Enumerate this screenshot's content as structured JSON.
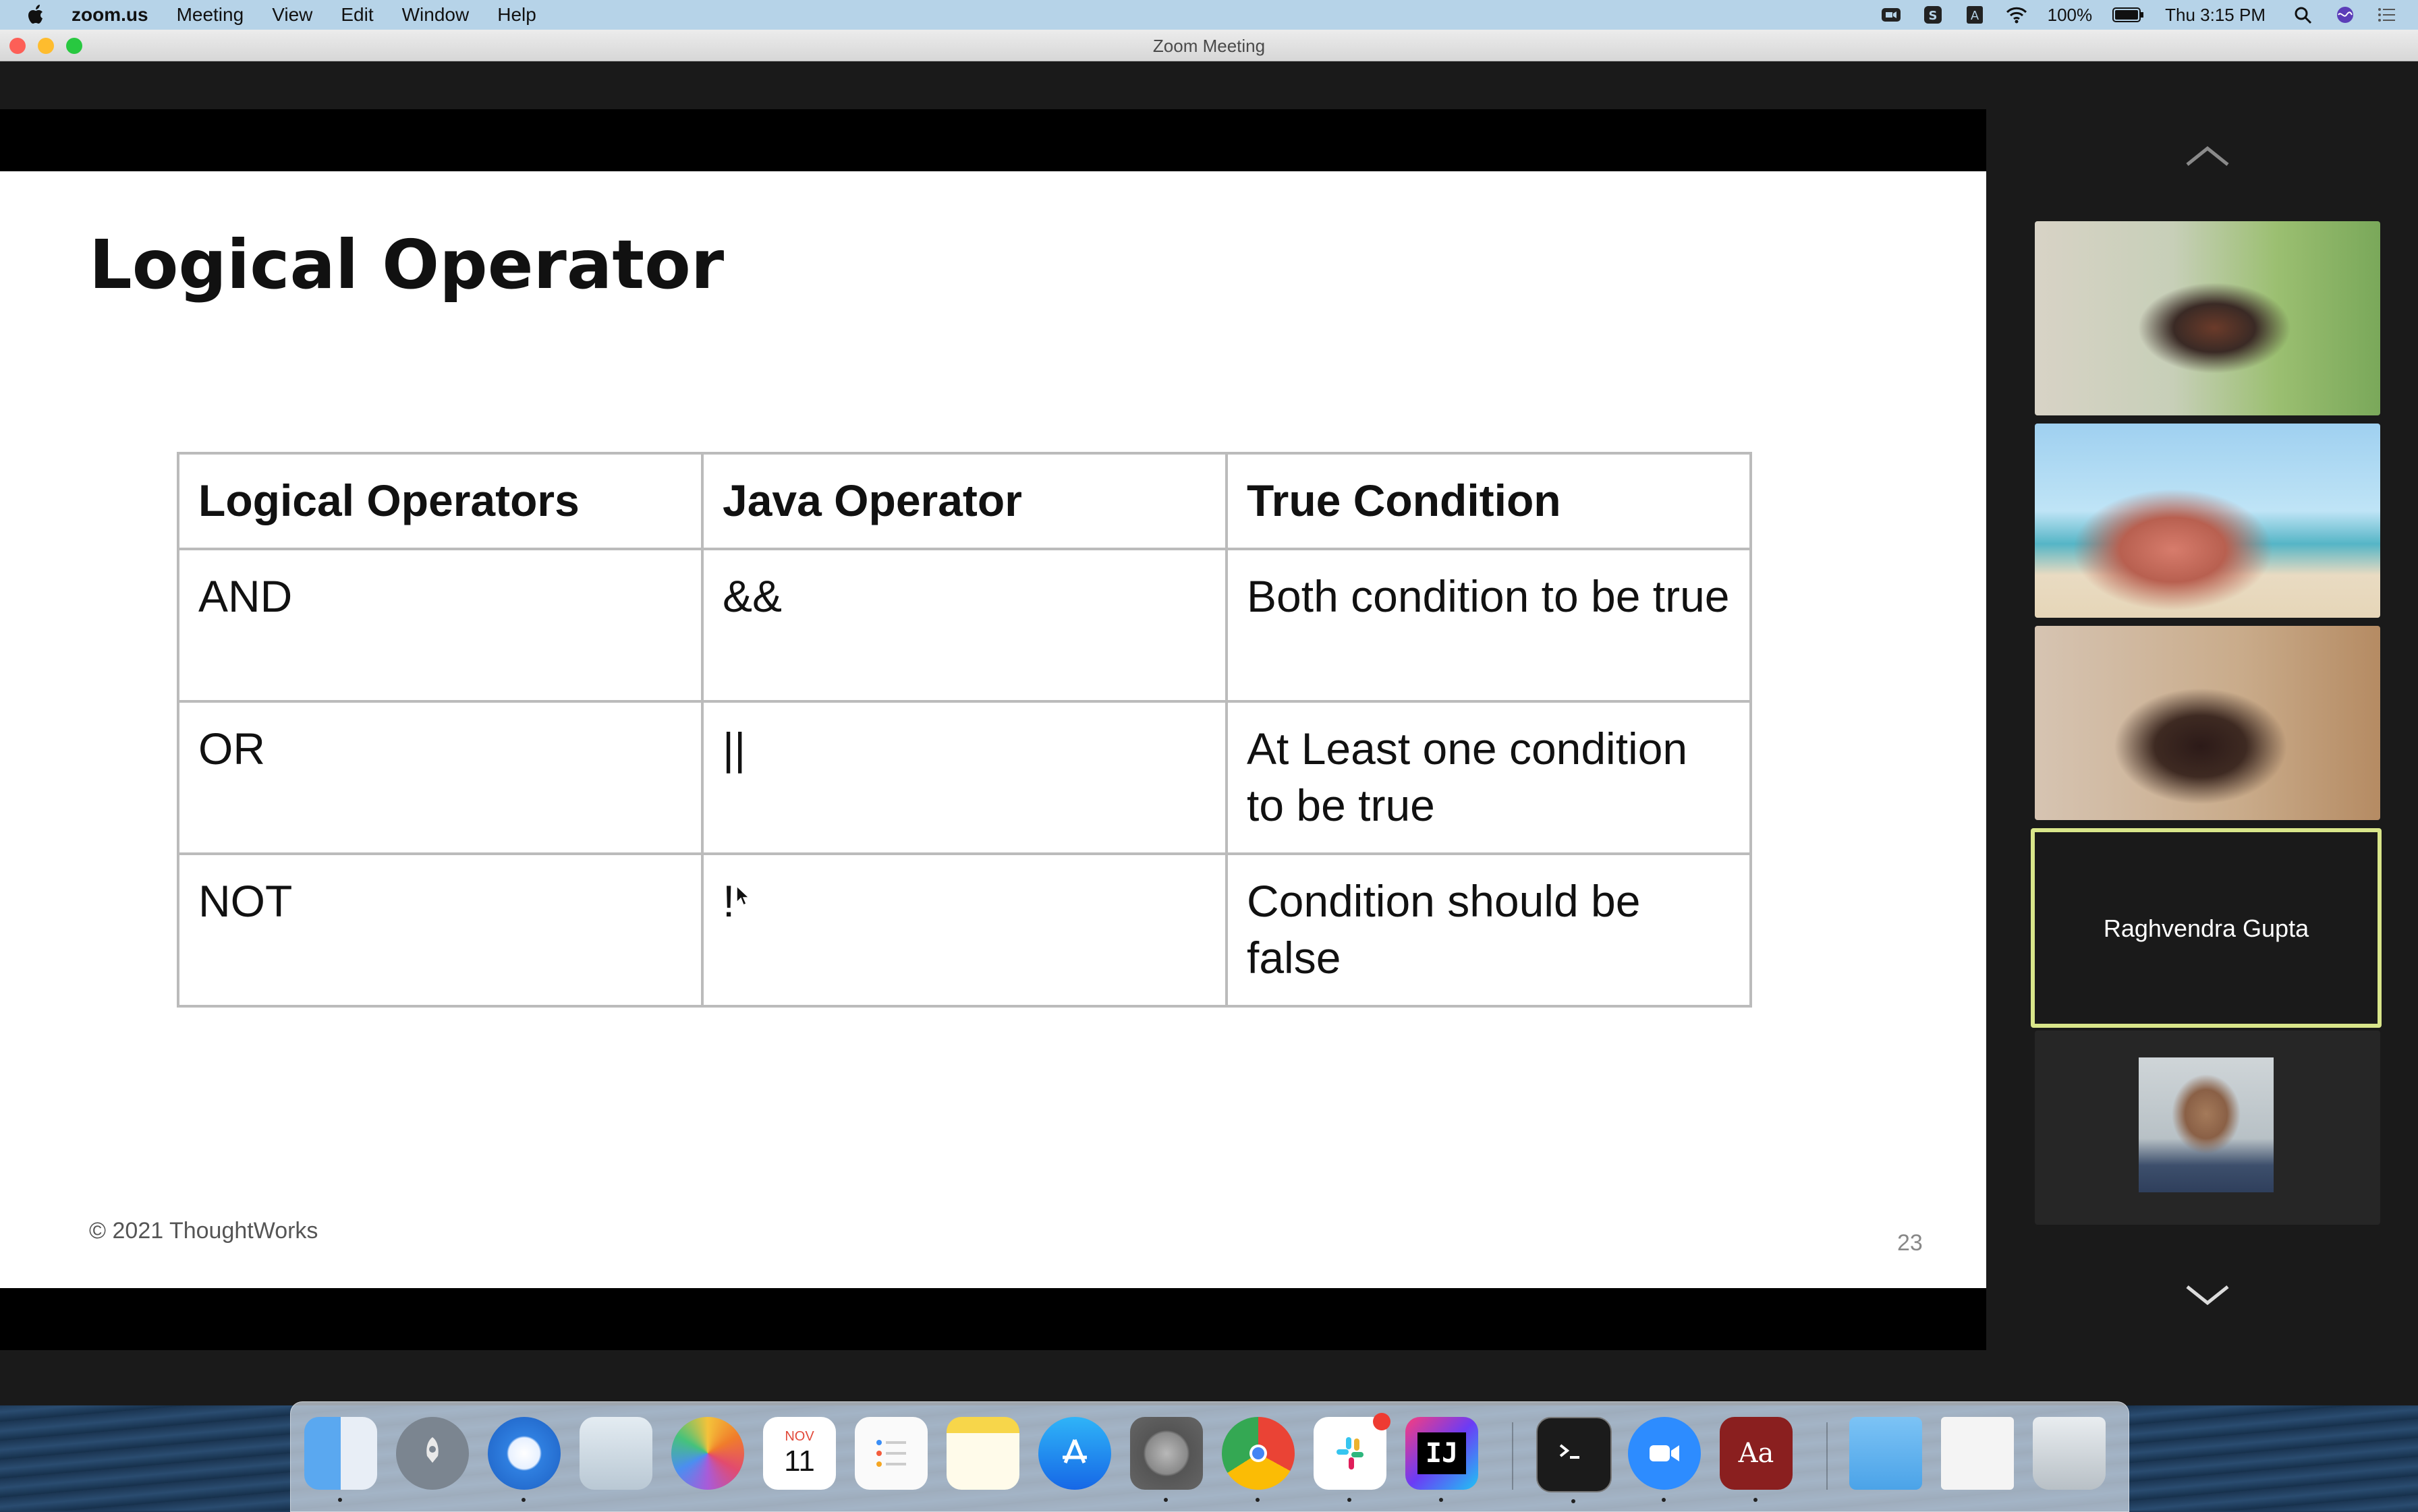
{
  "menubar": {
    "app_name": "zoom.us",
    "menus": [
      "Meeting",
      "View",
      "Edit",
      "Window",
      "Help"
    ],
    "battery": "100%",
    "clock": "Thu 3:15 PM"
  },
  "window": {
    "title": "Zoom Meeting"
  },
  "slide": {
    "title": "Logical Operator",
    "table": {
      "headers": [
        "Logical Operators",
        "Java Operator",
        "True Condition"
      ],
      "rows": [
        [
          "AND",
          "&&",
          "Both condition to be true"
        ],
        [
          "OR",
          "||",
          "At Least one condition to be true"
        ],
        [
          "NOT",
          "!",
          "Condition should be false"
        ]
      ]
    },
    "footer": "© 2021 ThoughtWorks",
    "page_number": "23"
  },
  "participants": {
    "active_speaker_name": "Raghvendra Gupta"
  },
  "dock": {
    "calendar_month": "NOV",
    "calendar_day": "11",
    "intellij_label": "IJ",
    "dictionary_label": "Aa"
  },
  "colors": {
    "menubar": "#b6d3e8",
    "active_speaker_border": "#d9e68a",
    "window_bg": "#1a1a1a"
  }
}
